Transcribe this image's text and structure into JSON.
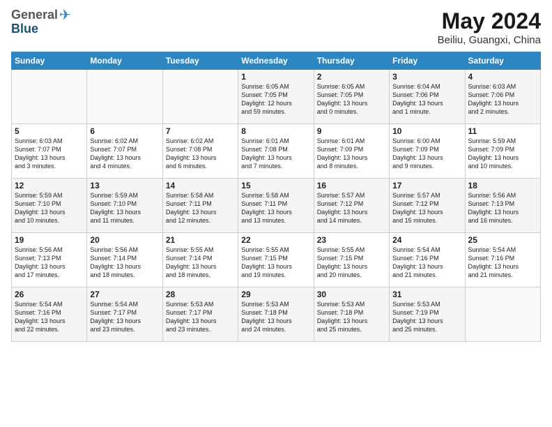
{
  "header": {
    "logo_general": "General",
    "logo_blue": "Blue",
    "title": "May 2024",
    "subtitle": "Beiliu, Guangxi, China"
  },
  "weekdays": [
    "Sunday",
    "Monday",
    "Tuesday",
    "Wednesday",
    "Thursday",
    "Friday",
    "Saturday"
  ],
  "weeks": [
    [
      {
        "day": "",
        "info": ""
      },
      {
        "day": "",
        "info": ""
      },
      {
        "day": "",
        "info": ""
      },
      {
        "day": "1",
        "info": "Sunrise: 6:05 AM\nSunset: 7:05 PM\nDaylight: 12 hours\nand 59 minutes."
      },
      {
        "day": "2",
        "info": "Sunrise: 6:05 AM\nSunset: 7:05 PM\nDaylight: 13 hours\nand 0 minutes."
      },
      {
        "day": "3",
        "info": "Sunrise: 6:04 AM\nSunset: 7:06 PM\nDaylight: 13 hours\nand 1 minute."
      },
      {
        "day": "4",
        "info": "Sunrise: 6:03 AM\nSunset: 7:06 PM\nDaylight: 13 hours\nand 2 minutes."
      }
    ],
    [
      {
        "day": "5",
        "info": "Sunrise: 6:03 AM\nSunset: 7:07 PM\nDaylight: 13 hours\nand 3 minutes."
      },
      {
        "day": "6",
        "info": "Sunrise: 6:02 AM\nSunset: 7:07 PM\nDaylight: 13 hours\nand 4 minutes."
      },
      {
        "day": "7",
        "info": "Sunrise: 6:02 AM\nSunset: 7:08 PM\nDaylight: 13 hours\nand 6 minutes."
      },
      {
        "day": "8",
        "info": "Sunrise: 6:01 AM\nSunset: 7:08 PM\nDaylight: 13 hours\nand 7 minutes."
      },
      {
        "day": "9",
        "info": "Sunrise: 6:01 AM\nSunset: 7:09 PM\nDaylight: 13 hours\nand 8 minutes."
      },
      {
        "day": "10",
        "info": "Sunrise: 6:00 AM\nSunset: 7:09 PM\nDaylight: 13 hours\nand 9 minutes."
      },
      {
        "day": "11",
        "info": "Sunrise: 5:59 AM\nSunset: 7:09 PM\nDaylight: 13 hours\nand 10 minutes."
      }
    ],
    [
      {
        "day": "12",
        "info": "Sunrise: 5:59 AM\nSunset: 7:10 PM\nDaylight: 13 hours\nand 10 minutes."
      },
      {
        "day": "13",
        "info": "Sunrise: 5:59 AM\nSunset: 7:10 PM\nDaylight: 13 hours\nand 11 minutes."
      },
      {
        "day": "14",
        "info": "Sunrise: 5:58 AM\nSunset: 7:11 PM\nDaylight: 13 hours\nand 12 minutes."
      },
      {
        "day": "15",
        "info": "Sunrise: 5:58 AM\nSunset: 7:11 PM\nDaylight: 13 hours\nand 13 minutes."
      },
      {
        "day": "16",
        "info": "Sunrise: 5:57 AM\nSunset: 7:12 PM\nDaylight: 13 hours\nand 14 minutes."
      },
      {
        "day": "17",
        "info": "Sunrise: 5:57 AM\nSunset: 7:12 PM\nDaylight: 13 hours\nand 15 minutes."
      },
      {
        "day": "18",
        "info": "Sunrise: 5:56 AM\nSunset: 7:13 PM\nDaylight: 13 hours\nand 16 minutes."
      }
    ],
    [
      {
        "day": "19",
        "info": "Sunrise: 5:56 AM\nSunset: 7:13 PM\nDaylight: 13 hours\nand 17 minutes."
      },
      {
        "day": "20",
        "info": "Sunrise: 5:56 AM\nSunset: 7:14 PM\nDaylight: 13 hours\nand 18 minutes."
      },
      {
        "day": "21",
        "info": "Sunrise: 5:55 AM\nSunset: 7:14 PM\nDaylight: 13 hours\nand 18 minutes."
      },
      {
        "day": "22",
        "info": "Sunrise: 5:55 AM\nSunset: 7:15 PM\nDaylight: 13 hours\nand 19 minutes."
      },
      {
        "day": "23",
        "info": "Sunrise: 5:55 AM\nSunset: 7:15 PM\nDaylight: 13 hours\nand 20 minutes."
      },
      {
        "day": "24",
        "info": "Sunrise: 5:54 AM\nSunset: 7:16 PM\nDaylight: 13 hours\nand 21 minutes."
      },
      {
        "day": "25",
        "info": "Sunrise: 5:54 AM\nSunset: 7:16 PM\nDaylight: 13 hours\nand 21 minutes."
      }
    ],
    [
      {
        "day": "26",
        "info": "Sunrise: 5:54 AM\nSunset: 7:16 PM\nDaylight: 13 hours\nand 22 minutes."
      },
      {
        "day": "27",
        "info": "Sunrise: 5:54 AM\nSunset: 7:17 PM\nDaylight: 13 hours\nand 23 minutes."
      },
      {
        "day": "28",
        "info": "Sunrise: 5:53 AM\nSunset: 7:17 PM\nDaylight: 13 hours\nand 23 minutes."
      },
      {
        "day": "29",
        "info": "Sunrise: 5:53 AM\nSunset: 7:18 PM\nDaylight: 13 hours\nand 24 minutes."
      },
      {
        "day": "30",
        "info": "Sunrise: 5:53 AM\nSunset: 7:18 PM\nDaylight: 13 hours\nand 25 minutes."
      },
      {
        "day": "31",
        "info": "Sunrise: 5:53 AM\nSunset: 7:19 PM\nDaylight: 13 hours\nand 25 minutes."
      },
      {
        "day": "",
        "info": ""
      }
    ]
  ]
}
